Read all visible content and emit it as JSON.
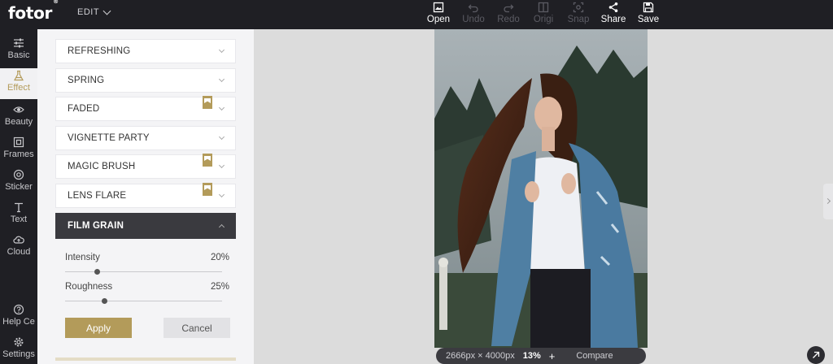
{
  "header": {
    "logo": "fotor",
    "logo_mark": "®",
    "edit_label": "EDIT",
    "tools": [
      {
        "label": "Open",
        "icon": "open-image-icon",
        "enabled": true
      },
      {
        "label": "Undo",
        "icon": "undo-icon",
        "enabled": false
      },
      {
        "label": "Redo",
        "icon": "redo-icon",
        "enabled": false
      },
      {
        "label": "Origi",
        "icon": "original-icon",
        "enabled": false
      },
      {
        "label": "Snap",
        "icon": "snapshot-icon",
        "enabled": false
      },
      {
        "label": "Share",
        "icon": "share-icon",
        "enabled": true
      },
      {
        "label": "Save",
        "icon": "save-icon",
        "enabled": true
      }
    ]
  },
  "sidebar": {
    "items": [
      {
        "label": "Basic",
        "icon": "sliders-icon"
      },
      {
        "label": "Effect",
        "icon": "flask-icon",
        "active": true
      },
      {
        "label": "Beauty",
        "icon": "eye-icon"
      },
      {
        "label": "Frames",
        "icon": "frame-icon"
      },
      {
        "label": "Sticker",
        "icon": "sticker-icon"
      },
      {
        "label": "Text",
        "icon": "text-icon"
      },
      {
        "label": "Cloud",
        "icon": "cloud-icon"
      },
      {
        "label": "Help Ce",
        "icon": "help-icon"
      },
      {
        "label": "Settings",
        "icon": "settings-icon"
      }
    ]
  },
  "effects": {
    "categories": [
      {
        "label": "REFRESHING",
        "premium": false
      },
      {
        "label": "SPRING",
        "premium": false
      },
      {
        "label": "FADED",
        "premium": true
      },
      {
        "label": "VIGNETTE PARTY",
        "premium": false
      },
      {
        "label": "MAGIC BRUSH",
        "premium": true
      },
      {
        "label": "LENS FLARE",
        "premium": true
      },
      {
        "label": "FILM GRAIN",
        "premium": false,
        "open": true
      }
    ],
    "sliders": [
      {
        "label": "Intensity",
        "value": "20%",
        "level": 0.2
      },
      {
        "label": "Roughness",
        "value": "25%",
        "level": 0.25
      }
    ],
    "apply_label": "Apply",
    "cancel_label": "Cancel"
  },
  "canvas": {
    "dimensions": "2666px × 4000px",
    "zoom": "13%",
    "plus": "+",
    "compare_label": "Compare"
  },
  "colors": {
    "accent": "#b39b5a",
    "topbar": "#1f1f24",
    "open_category": "#3a3a3f"
  }
}
